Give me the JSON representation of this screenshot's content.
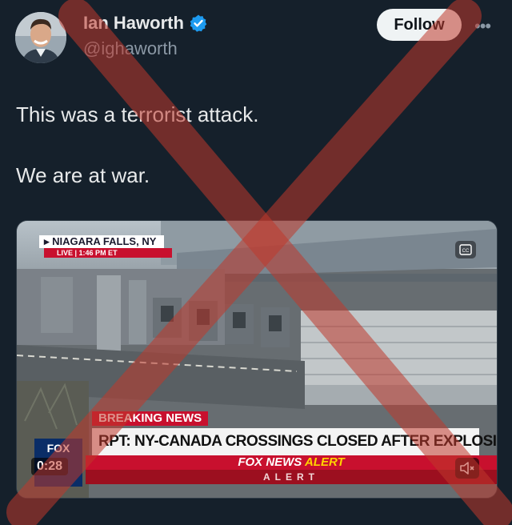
{
  "author": {
    "display_name": "Ian Haworth",
    "handle": "@ighaworth",
    "verified": true
  },
  "header": {
    "follow_label": "Follow",
    "more_icon": "more-horizontal-icon"
  },
  "tweet": {
    "lines": [
      "This was a terrorist attack.",
      "We are at war."
    ]
  },
  "media": {
    "chyron_location": "NIAGARA FALLS, NY",
    "chyron_live": "LIVE",
    "chyron_time": "1:46 PM ET",
    "breaking_label": "BREAKING",
    "breaking_label_2": "NEWS",
    "headline": "RPT: NY-CANADA CROSSINGS CLOSED AFTER EXPLOSION",
    "alert_brand": "FOX NEWS",
    "alert_word": "ALERT",
    "alert_strip": "ALERT",
    "network_logo": "FOX",
    "timestamp": "0:28",
    "captions_icon": "captions-icon",
    "mute_icon": "volume-muted-icon"
  },
  "colors": {
    "background": "#15202b",
    "verified_badge": "#1d9bf0",
    "overlay_x": "#c0392b"
  }
}
